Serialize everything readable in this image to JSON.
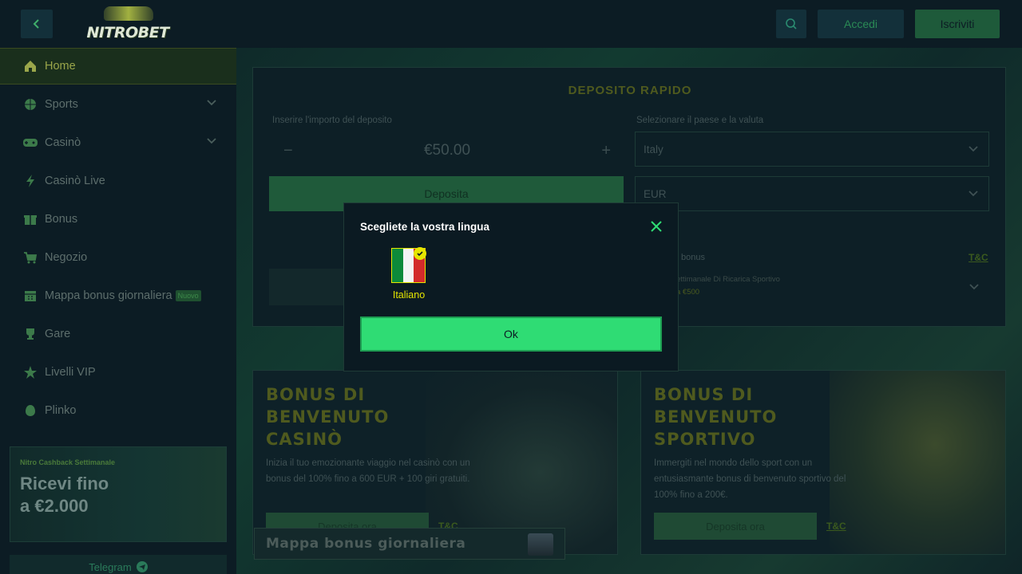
{
  "header": {
    "logo_text": "NITROBET",
    "login_label": "Accedi",
    "register_label": "Iscriviti"
  },
  "sidebar": {
    "items": [
      {
        "label": "Home",
        "icon": "home-icon"
      },
      {
        "label": "Sports",
        "icon": "ball-icon"
      },
      {
        "label": "Casinò",
        "icon": "gamepad-icon"
      },
      {
        "label": "Casinò Live",
        "icon": "lightning-icon"
      },
      {
        "label": "Bonus",
        "icon": "gift-icon"
      },
      {
        "label": "Negozio",
        "icon": "cart-icon"
      },
      {
        "label": "Mappa bonus giornaliera",
        "icon": "calendar-icon",
        "badge": "Nuovo"
      },
      {
        "label": "Gare",
        "icon": "trophy-icon"
      },
      {
        "label": "Livelli VIP",
        "icon": "star-icon"
      },
      {
        "label": "Plinko",
        "icon": "plinko-icon"
      }
    ],
    "cashback": {
      "small": "Nitro Cashback Settimanale",
      "line1": "Ricevi fino",
      "line2": "a €2.000"
    },
    "telegram_label": "Telegram"
  },
  "deposit": {
    "title": "DEPOSITO RAPIDO",
    "amount_label": "Inserire l'importo del deposito",
    "amount_value": "€50.00",
    "country_label": "Selezionare il paese e la valuta",
    "country_value": "Italy",
    "currency_value": "EUR",
    "deposit_button": "Deposita",
    "bonus_label": "bonus",
    "tsc": "T&C",
    "bonus_sub": "ettimanale Di Ricarica Sportivo",
    "bonus_sub2": "a €500"
  },
  "promos": {
    "casino": {
      "title_l1": "BONUS DI",
      "title_l2": "BENVENUTO",
      "title_l3": "CASINÒ",
      "text": "Inizia il tuo emozionante viaggio nel casinò con un bonus del 100% fino a 600 EUR + 100 giri gratuiti.",
      "button": "Deposita ora",
      "tsc": "T&C"
    },
    "sport": {
      "title_l1": "BONUS DI",
      "title_l2": "BENVENUTO",
      "title_l3": "SPORTIVO",
      "text": "Immergiti nel mondo dello sport con un entusiasmante bonus di benvenuto sportivo del 100% fino a 200€.",
      "button": "Deposita ora",
      "tsc": "T&C"
    }
  },
  "map_banner": "Mappa bonus giornaliera",
  "modal": {
    "title": "Scegliete la vostra lingua",
    "language_label": "Italiano",
    "ok_label": "Ok"
  },
  "colors": {
    "accent_green": "#2fdc74",
    "selected_yellow": "#e6e600",
    "background": "#0b1a22"
  }
}
